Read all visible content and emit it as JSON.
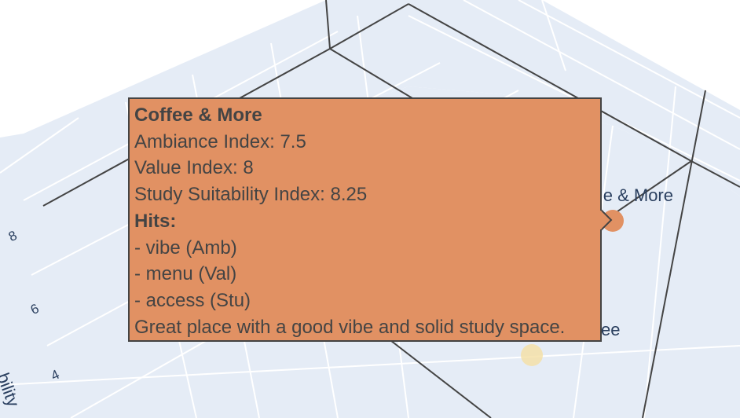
{
  "chart_data": {
    "type": "scatter3d",
    "axes": {
      "z": {
        "title": "Study Suitability Index",
        "title_visible": "bility",
        "ticks": [
          "4",
          "6",
          "8"
        ]
      }
    },
    "points": [
      {
        "name": "Coffee & More",
        "label_visible": "e & More",
        "color": "#e19163",
        "ambiance": 7.5,
        "value": 8,
        "study": 8.25
      },
      {
        "name": "…ee",
        "label_visible": "ee",
        "color": "#f5e0a8"
      }
    ],
    "background_color": "#e5ecf6",
    "grid_color": "#ffffff"
  },
  "tooltip": {
    "title": "Coffee & More",
    "ambiance": "Ambiance Index: 7.5",
    "value": "Value Index: 8",
    "study": "Study Suitability Index: 8.25",
    "hits_title": "Hits:",
    "hits": [
      "- vibe (Amb)",
      "- menu (Val)",
      "- access (Stu)"
    ],
    "note": "Great place with a good vibe and solid study space.",
    "background": "#e19163",
    "border": "#444444"
  }
}
